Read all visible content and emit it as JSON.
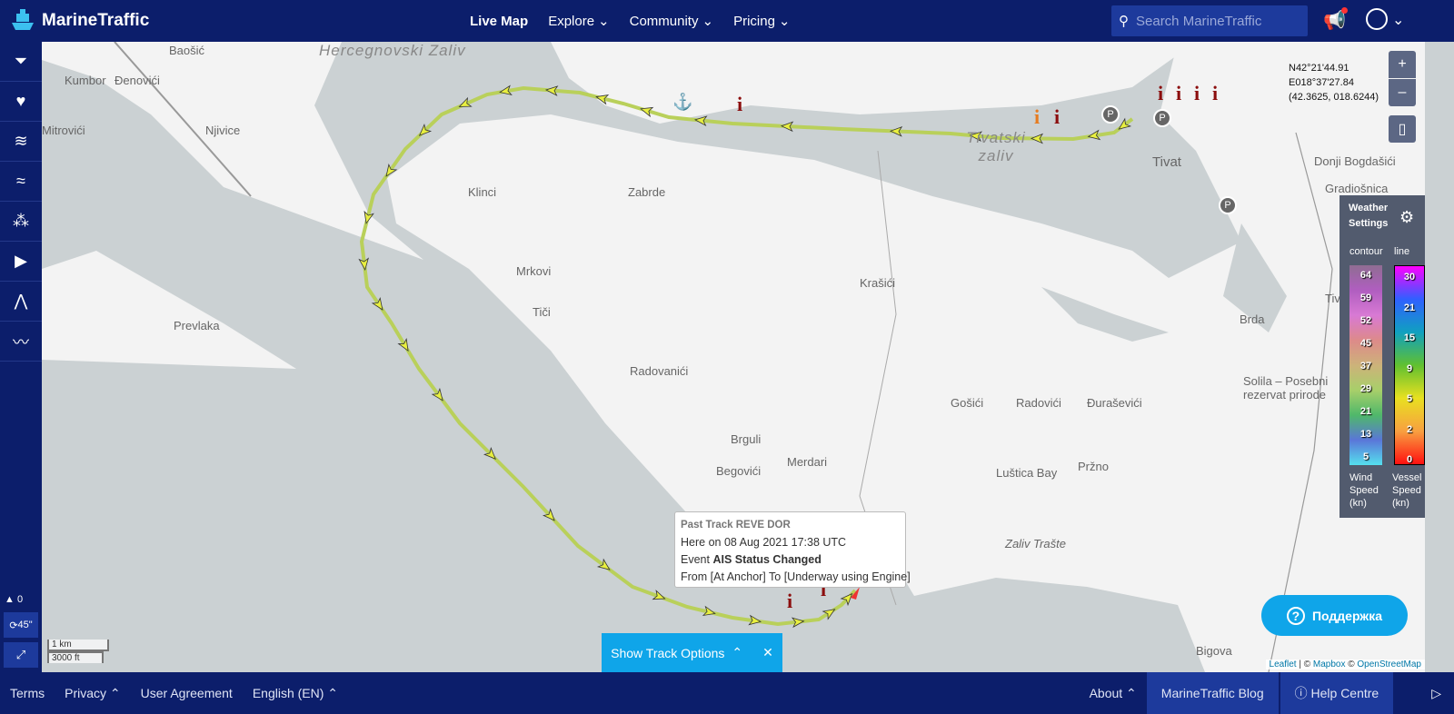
{
  "header": {
    "brand": "MarineTraffic",
    "nav": [
      {
        "label": "Live Map",
        "active": true
      },
      {
        "label": "Explore"
      },
      {
        "label": "Community"
      },
      {
        "label": "Pricing"
      }
    ],
    "search_placeholder": "Search MarineTraffic"
  },
  "sidebar": {
    "items": [
      "filter-icon",
      "heart-icon",
      "layers-icon",
      "wind-icon",
      "density-icon",
      "play-icon",
      "measure-icon",
      "track-icon"
    ],
    "vessel_count": "0",
    "refresh": "45\""
  },
  "map": {
    "places": [
      "Kumbor",
      "Đenovići",
      "Baošić",
      "Njivice",
      "Mitrovići",
      "Klinci",
      "Zabrde",
      "Mrkovi",
      "Tiči",
      "Prevlaka",
      "Radovanići",
      "Brguli",
      "Begovići",
      "Merdari",
      "Krašići",
      "Gošići",
      "Radovići",
      "Đuraševići",
      "Luštica Bay",
      "Pržno",
      "Tivat",
      "Donji Bogdašići",
      "Gradiošnica",
      "Tivat Airport",
      "Brda",
      "Solila – Posebni rezervat prirode",
      "Bigova",
      "Zaliv Trašte"
    ],
    "water_labels": [
      "Hercegnovski Zaliv",
      "Tivatski zaliv"
    ],
    "coordinates": {
      "lat_dms": "N42°21'44.91",
      "lon_dms": "E018°37'27.84",
      "decimal": "(42.3625, 018.6244)"
    },
    "zoom_in": "+",
    "zoom_out": "–",
    "scale": {
      "metric": "1 km",
      "imperial": "3000 ft"
    },
    "attribution": {
      "leaflet": "Leaflet",
      "sep": " | © ",
      "mapbox": "Mapbox",
      "sep2": " © ",
      "osm": "OpenStreetMap"
    },
    "track_options": "Show Track Options",
    "support": "Поддержка"
  },
  "weather": {
    "title": "Weather Settings",
    "contour": "contour",
    "line": "line",
    "wind_values": [
      "64",
      "59",
      "52",
      "45",
      "37",
      "29",
      "21",
      "13",
      "5"
    ],
    "vessel_values": [
      "30",
      "21",
      "15",
      "9",
      "5",
      "2",
      "0"
    ],
    "wind_label": "Wind Speed (kn)",
    "vessel_label": "Vessel Speed (kn)"
  },
  "popup": {
    "title": "Past Track REVE DOR",
    "here": "Here on 08 Aug 2021 17:38 UTC",
    "event_prefix": "Event ",
    "event": "AIS Status Changed",
    "from_to": "From [At Anchor] To [Underway using Engine]"
  },
  "footer": {
    "terms": "Terms",
    "privacy": "Privacy",
    "agreement": "User Agreement",
    "language": "English (EN)",
    "about": "About",
    "blog": "MarineTraffic Blog",
    "help": "Help Centre"
  },
  "colors": {
    "navy": "#0c1e6b",
    "accent": "#1d3a9c",
    "support": "#0fa5e9"
  }
}
